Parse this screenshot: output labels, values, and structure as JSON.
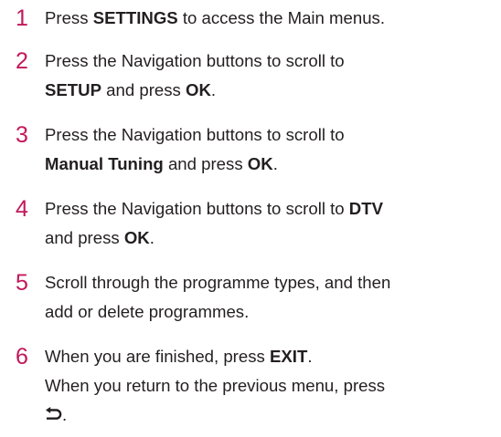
{
  "steps": [
    {
      "number": "1",
      "parts": [
        {
          "text": "Press ",
          "bold": false
        },
        {
          "text": "SETTINGS",
          "bold": true
        },
        {
          "text": " to access the Main menus.",
          "bold": false
        }
      ]
    },
    {
      "number": "2",
      "parts": [
        {
          "text": "Press the Navigation buttons to scroll to",
          "bold": false
        },
        {
          "text": "\n",
          "break": true
        },
        {
          "text": "SETUP",
          "bold": true
        },
        {
          "text": " and press ",
          "bold": false
        },
        {
          "text": "OK",
          "bold": true
        },
        {
          "text": ".",
          "bold": false
        }
      ]
    },
    {
      "number": "3",
      "parts": [
        {
          "text": "Press the Navigation buttons to scroll to",
          "bold": false
        },
        {
          "text": "\n",
          "break": true
        },
        {
          "text": "Manual Tuning",
          "bold": true
        },
        {
          "text": " and press ",
          "bold": false
        },
        {
          "text": "OK",
          "bold": true
        },
        {
          "text": ".",
          "bold": false
        }
      ]
    },
    {
      "number": "4",
      "parts": [
        {
          "text": "Press the Navigation buttons to scroll to ",
          "bold": false
        },
        {
          "text": "DTV",
          "bold": true
        },
        {
          "text": "\n",
          "break": true
        },
        {
          "text": "and press ",
          "bold": false
        },
        {
          "text": "OK",
          "bold": true
        },
        {
          "text": ".",
          "bold": false
        }
      ]
    },
    {
      "number": "5",
      "parts": [
        {
          "text": "Scroll through the programme types, and then",
          "bold": false
        },
        {
          "text": "\n",
          "break": true
        },
        {
          "text": "add or delete programmes.",
          "bold": false
        }
      ]
    },
    {
      "number": "6",
      "parts": [
        {
          "text": "When you are finished, press ",
          "bold": false
        },
        {
          "text": "EXIT",
          "bold": true
        },
        {
          "text": ".",
          "bold": false
        },
        {
          "text": "\n",
          "break": true
        },
        {
          "text": "When you return to the previous menu, press",
          "bold": false
        },
        {
          "text": "\n",
          "break": true
        },
        {
          "icon": "back-arrow-icon"
        },
        {
          "text": ".",
          "bold": false
        }
      ]
    }
  ],
  "colors": {
    "step_number": "#c2185b",
    "text": "#231f20"
  }
}
